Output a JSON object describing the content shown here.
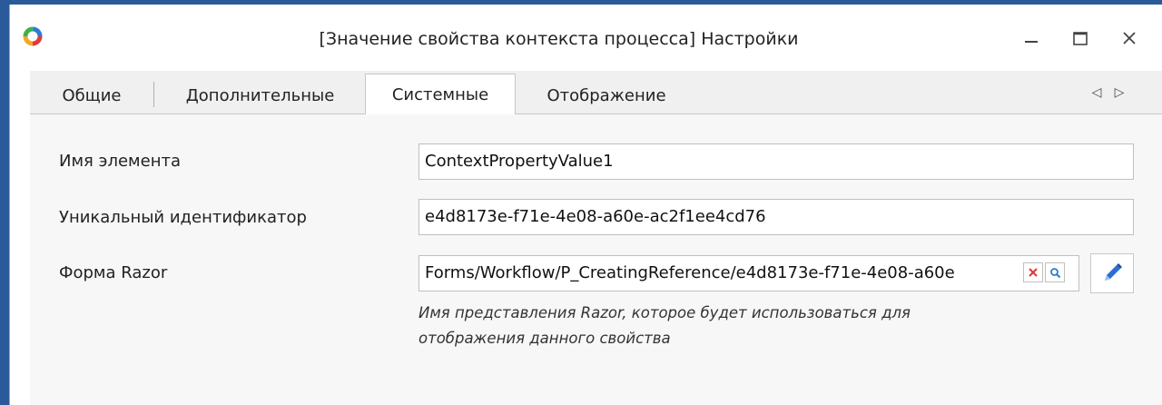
{
  "window": {
    "title": "[Значение свойства контекста процесса] Настройки",
    "minimize_icon": "minimize-icon",
    "maximize_icon": "maximize-icon",
    "close_icon": "close-icon"
  },
  "tabs": [
    {
      "label": "Общие",
      "active": false
    },
    {
      "label": "Дополнительные",
      "active": false
    },
    {
      "label": "Системные",
      "active": true
    },
    {
      "label": "Отображение",
      "active": false
    }
  ],
  "tab_scroll": {
    "left": "◁",
    "right": "▷"
  },
  "form": {
    "element_name_label": "Имя элемента",
    "element_name_value": "ContextPropertyValue1",
    "uid_label": "Уникальный идентификатор",
    "uid_value": "e4d8173e-f71e-4e08-a60e-ac2f1ee4cd76",
    "razor_label": "Форма Razor",
    "razor_value": "Forms/Workflow/P_CreatingReference/e4d8173e-f71e-4e08-a60e",
    "razor_hint_line1": "Имя представления Razor, которое будет использоваться для",
    "razor_hint_line2": "отображения данного свойства"
  },
  "colors": {
    "accent": "#2a5a9a",
    "clear_red": "#e23b3b",
    "search_blue": "#2b7bd6",
    "pencil_blue": "#2d6fd1"
  }
}
